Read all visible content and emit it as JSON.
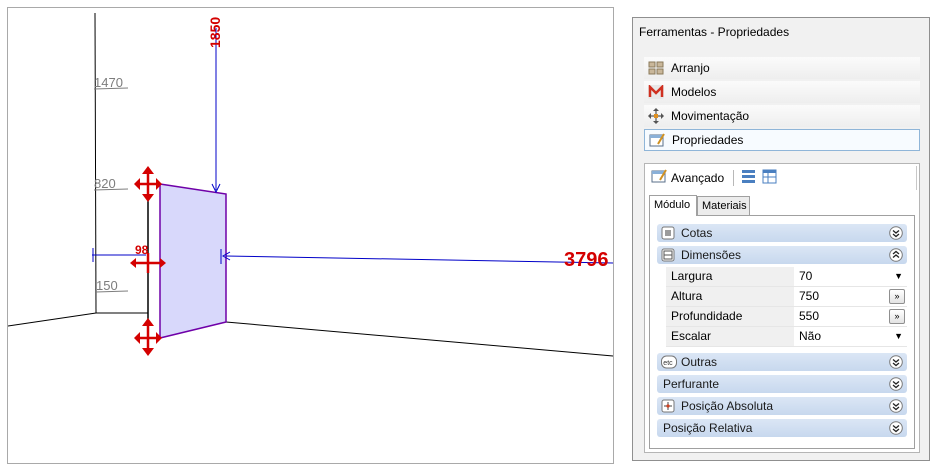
{
  "viewport": {
    "dimensions": {
      "d1470": "1470",
      "d820": "820",
      "d150": "150",
      "d1850": "1850",
      "d98": "98",
      "d3796": "3796"
    },
    "colors": {
      "panel_fill": "#d8d8fb",
      "dim_line": "#0000c8",
      "handle": "#d40000"
    }
  },
  "panel": {
    "title": "Ferramentas - Propriedades",
    "nav": [
      {
        "label": "Arranjo",
        "icon": "arrange-icon"
      },
      {
        "label": "Modelos",
        "icon": "models-icon"
      },
      {
        "label": "Movimentação",
        "icon": "move-icon"
      },
      {
        "label": "Propriedades",
        "icon": "properties-icon"
      }
    ],
    "toolbar": {
      "advanced_label": "Avançado"
    },
    "tabs": [
      "Módulo",
      "Materiais"
    ],
    "sections": {
      "cotas": "Cotas",
      "dimensoes": "Dimensões",
      "outras": "Outras",
      "perfurante": "Perfurante",
      "posicao_absoluta": "Posição Absoluta",
      "posicao_relativa": "Posição Relativa"
    },
    "properties": [
      {
        "name": "Largura",
        "value": "70",
        "control": "dropdown"
      },
      {
        "name": "Altura",
        "value": "750",
        "control": "button",
        "button_label": "»"
      },
      {
        "name": "Profundidade",
        "value": "550",
        "control": "button",
        "button_label": "»"
      },
      {
        "name": "Escalar",
        "value": "Não",
        "control": "dropdown"
      }
    ],
    "dropdown_glyph": "▼"
  }
}
